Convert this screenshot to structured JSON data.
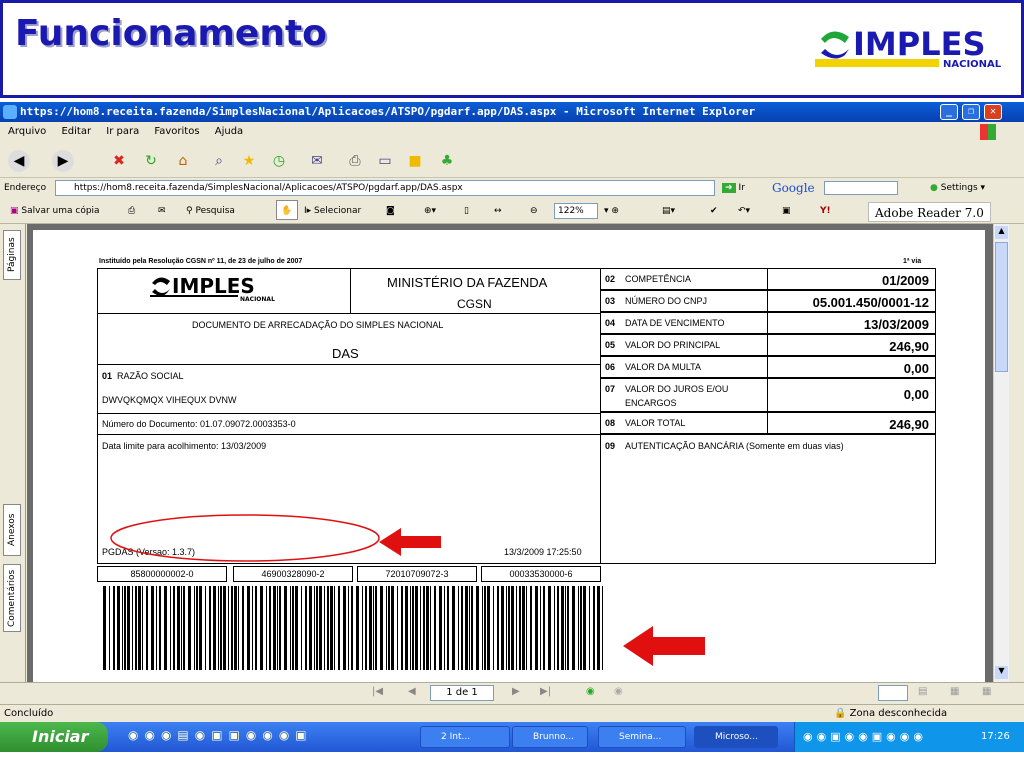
{
  "slide": {
    "title": "Funcionamento",
    "logo_text": "IMPLES",
    "logo_sub": "NACIONAL"
  },
  "window": {
    "title": "https://hom8.receita.fazenda/SimplesNacional/Aplicacoes/ATSPO/pgdarf.app/DAS.aspx - Microsoft Internet Explorer",
    "menu": [
      "Arquivo",
      "Editar",
      "Ir para",
      "Favoritos",
      "Ajuda"
    ],
    "address_label": "Endereço",
    "address": "https://hom8.receita.fazenda/SimplesNacional/Aplicacoes/ATSPO/pgdarf.app/DAS.aspx",
    "go_label": "Ir",
    "google_label": "Google",
    "settings_label": "Settings",
    "toolbar2": {
      "save": "Salvar uma cópia",
      "search": "Pesquisa",
      "select": "Selecionar",
      "zoom": "122%",
      "adobe": "Adobe Reader 7.0"
    },
    "sidetabs": [
      "Páginas",
      "Anexos",
      "Comentários"
    ],
    "page_nav": "1 de 1",
    "status_left": "Concluído",
    "status_zone": "Zona desconhecida"
  },
  "taskbar": {
    "start": "Iniciar",
    "items": [
      "2 Int...",
      "Brunno...",
      "Semina...",
      "Microso..."
    ],
    "clock": "17:26"
  },
  "das": {
    "header_note": "Instituído pela Resolução CGSN nº 11, de 23 de julho de 2007",
    "via": "1ª via",
    "logo": "IMPLES",
    "logo_sub": "NACIONAL",
    "ministry": "MINISTÉRIO DA FAZENDA",
    "cgsn": "CGSN",
    "doc_title": "DOCUMENTO DE ARRECADAÇÃO DO SIMPLES NACIONAL",
    "das": "DAS",
    "f01_num": "01",
    "f01_label": "RAZÃO SOCIAL",
    "razao": "DWVQKQMQX VIHEQUX DVNW",
    "num_doc": "Número do Documento: 01.07.09072.0003353-0",
    "data_limite": "Data limite para acolhimento: 13/03/2009",
    "pgdas": "PGDAS (Versao: 1.3.7)",
    "timestamp": "13/3/2009 17:25:50",
    "fields": [
      {
        "num": "02",
        "label": "COMPETÊNCIA",
        "value": "01/2009"
      },
      {
        "num": "03",
        "label": "NÚMERO DO CNPJ",
        "value": "05.001.450/0001-12"
      },
      {
        "num": "04",
        "label": "DATA DE VENCIMENTO",
        "value": "13/03/2009"
      },
      {
        "num": "05",
        "label": "VALOR DO PRINCIPAL",
        "value": "246,90"
      },
      {
        "num": "06",
        "label": "VALOR DA MULTA",
        "value": "0,00"
      },
      {
        "num": "07",
        "label": "VALOR DO JUROS E/OU",
        "label2": "ENCARGOS",
        "value": "0,00"
      },
      {
        "num": "08",
        "label": "VALOR TOTAL",
        "value": "246,90"
      },
      {
        "num": "09",
        "label": "AUTENTICAÇÃO BANCÁRIA (Somente em duas vias)",
        "value": ""
      }
    ],
    "barcode_groups": [
      "85800000002-0",
      "46900328090-2",
      "72010709072-3",
      "00033530000-6"
    ]
  },
  "colors": {
    "slide_blue": "#1a1ab0",
    "xp_blue": "#0a5fd8",
    "annotation_red": "#e01010",
    "start_green": "#2f8f2f"
  }
}
